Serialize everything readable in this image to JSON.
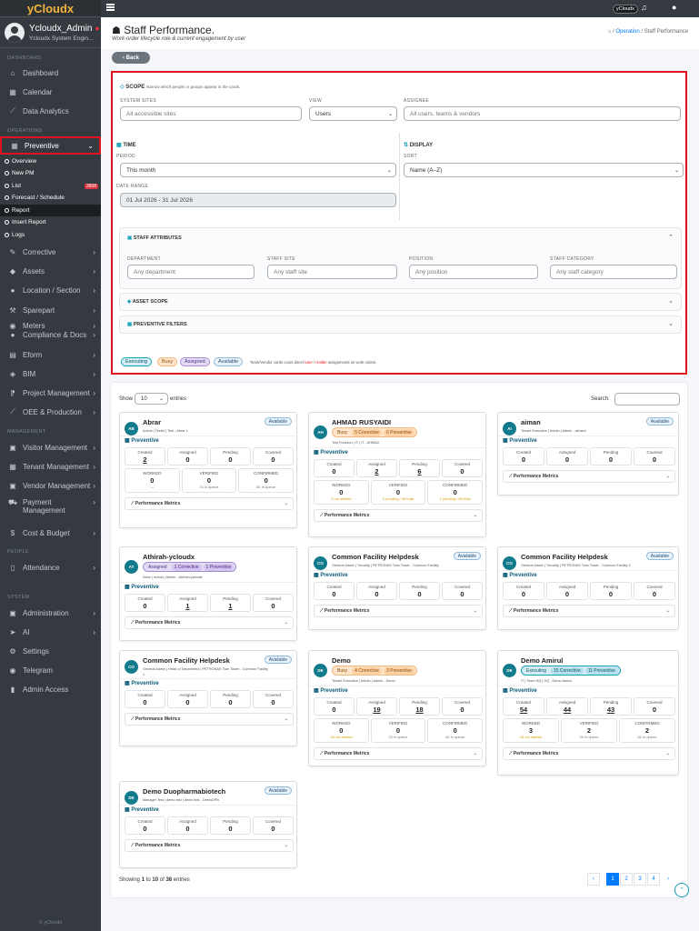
{
  "brand": "yCloudx",
  "user": {
    "name": "Ycloudx_Admin",
    "role": "Ycloudx System Engin..."
  },
  "sidebar": {
    "sec_dashboard": "DASHBOARD",
    "dashboard": "Dashboard",
    "calendar": "Calendar",
    "analytics": "Data Analytics",
    "sec_operations": "OPERATIONS",
    "preventive": "Preventive",
    "sub": [
      "Overview",
      "New PM",
      "List",
      "Forecast / Schedule",
      "Report",
      "Insert Report",
      "Logs"
    ],
    "list_badge": "3908",
    "corrective": "Corrective",
    "assets": "Assets",
    "location": "Location / Section",
    "sparepart": "Sparepart",
    "meters": "Meters",
    "compliance": "Compliance & Docs",
    "eform": "Eform",
    "bim": "BIM",
    "project": "Project Management",
    "oee": "OEE & Production",
    "sec_management": "MANAGEMENT",
    "visitor": "Visitor Management",
    "tenant": "Tenant Management",
    "vendor": "Vendor Management",
    "payment1": "Payment",
    "payment2": "Management",
    "cost": "Cost & Budget",
    "sec_people": "PEOPLE",
    "attendance": "Attendance",
    "sec_system": "SYSTEM",
    "administration": "Administration",
    "ai": "AI",
    "settings": "Settings",
    "telegram": "Telegram",
    "admin_access": "Admin Access",
    "footer": "© yCloudx"
  },
  "topbar": {
    "badge": "yCloudx"
  },
  "header": {
    "title": "Staff Performance.",
    "subtitle": "Work-order lifecycle role & current engagement by user",
    "crumb_op": "Operation",
    "crumb_sep": "/",
    "crumb_cur": "Staff Performance"
  },
  "back": "Back",
  "filter": {
    "scope_title": "SCOPE",
    "scope_hint": "Narrow which people or groups appear in the cards.",
    "sites_label": "SYSTEM SITES",
    "sites_ph": "All accessible sites",
    "view_label": "VIEW",
    "view_val": "Users",
    "assignee_label": "ASSIGNEE",
    "assignee_ph": "All users, teams & vendors",
    "time_title": "TIME",
    "period_label": "PERIOD",
    "period_val": "This month",
    "daterange_label": "DATE RANGE",
    "daterange_val": "01 Jul 2026 - 31 Jul 2026",
    "display_title": "DISPLAY",
    "sort_label": "SORT",
    "sort_val": "Name (A–Z)",
    "attr_title": "STAFF ATTRIBUTES",
    "dept_label": "DEPARTMENT",
    "dept_ph": "Any department",
    "staffsite_label": "STAFF SITE",
    "staffsite_ph": "Any staff site",
    "position_label": "POSITION",
    "position_ph": "Any position",
    "category_label": "STAFF CATEGORY",
    "category_ph": "Any staff category",
    "asset_title": "ASSET SCOPE",
    "prev_title": "PREVENTIVE FILTERS",
    "legend": [
      "Executing",
      "Busy",
      "Assigned",
      "Available"
    ],
    "legend_note1": "Team/Vendor cards count direct",
    "legend_user": "User",
    "legend_mid": "/",
    "legend_holder": "Holder",
    "legend_note2": "assignments on work orders."
  },
  "table": {
    "show": "Show",
    "entries_val": "10",
    "entries": "entries",
    "search": "Search:",
    "showing_pre": "Showing",
    "showing_a": "1",
    "showing_to": "to",
    "showing_b": "10",
    "showing_of": "of",
    "showing_c": "38",
    "showing_post": "entries",
    "pages": [
      "1",
      "2",
      "3",
      "4"
    ]
  },
  "labels": {
    "preventive": "Preventive",
    "created": "Created",
    "assigned": "Assigned",
    "pending": "Pending",
    "covered": "Covered",
    "worked": "WORKED",
    "verified": "VERIFIED",
    "confirmed": "CONFIRMED",
    "metrics": "Performance Metrics"
  },
  "cards": [
    {
      "initials": "AB",
      "name": "Abrar",
      "sub": "Admin | Tester | Test - Abrar 1",
      "status": "Available",
      "created": "2",
      "assigned": "0",
      "pending": "0",
      "covered": "0",
      "worked": "0",
      "worked_sub": "—",
      "verified": "0",
      "verified_sub": "21 in queue",
      "confirmed": "0",
      "confirmed_sub": "82 in queue"
    },
    {
      "initials": "AH",
      "name": "AHMAD RUSYAIDI",
      "sub": "Test Function | IT | IT - AHMAD",
      "chips": [
        "Busy",
        "5 Corrective",
        "6 Preventive"
      ],
      "created": "0",
      "assigned": "2",
      "pending": "6",
      "covered": "0",
      "worked": "0",
      "worked_sub": "2 not started",
      "verified": "0",
      "verified_sub": "2 pending / 38 total",
      "confirmed": "0",
      "confirmed_sub": "2 pending / 83 total"
    },
    {
      "initials": "AI",
      "name": "aiman",
      "sub": "Tenant Executive | Admin | Admin - aiman1",
      "status": "Available",
      "created": "0",
      "assigned": "0",
      "pending": "0",
      "covered": "0"
    },
    {
      "initials": "AT",
      "name": "Athirah-ycloudx",
      "sub": "None | Admin | Admin - Athirah-ycloudx",
      "chips": [
        "Assigned",
        "1 Corrective",
        "1 Preventive"
      ],
      "created": "0",
      "assigned": "1",
      "pending": "1",
      "covered": "0"
    },
    {
      "initials": "CO",
      "name": "Common Facility Helpdesk",
      "sub": "General Admin | Security | PETRONAS Twin Tower - Common Facility",
      "status": "Available",
      "created": "0",
      "assigned": "0",
      "pending": "0",
      "covered": "0"
    },
    {
      "initials": "CO",
      "name": "Common Facility Helpdesk",
      "sub": "General Admin | Security | PETRONAS Twin Tower - Common Facility 2",
      "status": "Available",
      "created": "0",
      "assigned": "0",
      "pending": "0",
      "covered": "0"
    },
    {
      "initials": "CO",
      "name": "Common Facility Helpdesk",
      "sub": "General Admin | Head of Department | PETRONAS Twin Tower - Common Facility",
      "sub2": "1",
      "status": "Available",
      "created": "0",
      "assigned": "0",
      "pending": "0",
      "covered": "0"
    },
    {
      "initials": "DE",
      "name": "Demo",
      "sub": "Tenant Executive | Admin | Admin - Demo",
      "chips": [
        "Busy",
        "4 Corrective",
        "3 Preventive"
      ],
      "created": "0",
      "assigned": "19",
      "pending": "18",
      "covered": "0",
      "worked": "0",
      "worked_sub": "18 not started",
      "verified": "0",
      "verified_sub": "22 in queue",
      "confirmed": "0",
      "confirmed_sub": "82 in queue"
    },
    {
      "initials": "DE",
      "name": "Demo Amirul",
      "sub": "IT | Team HQ | HQ - Demo Amirul",
      "chips": [
        "Executing",
        "15 Corrective",
        "11 Preventive"
      ],
      "created": "54",
      "assigned": "44",
      "pending": "43",
      "covered": "0",
      "worked": "3",
      "worked_sub": "43 not started",
      "verified": "2",
      "verified_sub": "20 in queue",
      "confirmed": "2",
      "confirmed_sub": "82 in queue"
    },
    {
      "initials": "DE",
      "name": "Demo Duopharmabiotech",
      "sub": "Manager Test | demo test | demo test - DemoDPB",
      "status": "Available",
      "created": "0",
      "assigned": "0",
      "pending": "0",
      "covered": "0"
    }
  ]
}
